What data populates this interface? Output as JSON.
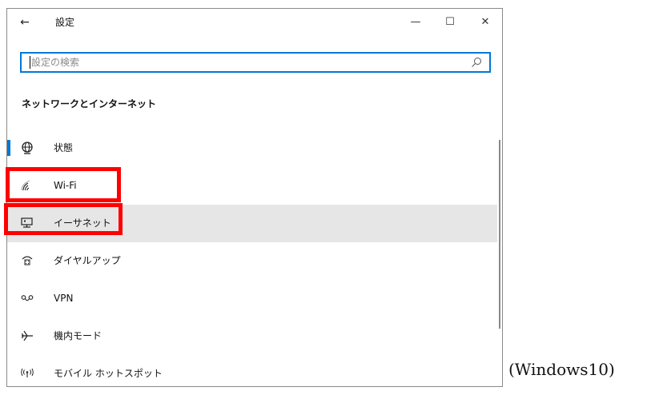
{
  "window": {
    "title": "設定",
    "back_glyph": "←",
    "minimize_glyph": "—",
    "maximize_glyph": "☐",
    "close_glyph": "✕"
  },
  "search": {
    "placeholder": "設定の検索",
    "value": ""
  },
  "section": {
    "title": "ネットワークとインターネット"
  },
  "nav": {
    "items": [
      {
        "label": "状態",
        "icon": "globe-icon",
        "selected": true
      },
      {
        "label": "Wi-Fi",
        "icon": "wifi-icon",
        "selected": false
      },
      {
        "label": "イーサネット",
        "icon": "ethernet-icon",
        "selected": false,
        "hover": true
      },
      {
        "label": "ダイヤルアップ",
        "icon": "dialup-icon",
        "selected": false
      },
      {
        "label": "VPN",
        "icon": "vpn-icon",
        "selected": false
      },
      {
        "label": "機内モード",
        "icon": "airplane-icon",
        "selected": false
      },
      {
        "label": "モバイル ホットスポット",
        "icon": "hotspot-icon",
        "selected": false
      }
    ]
  },
  "caption": "(Windows10)",
  "colors": {
    "accent": "#0078d7",
    "highlight": "#ff0000",
    "hover_bg": "#e6e6e6"
  }
}
